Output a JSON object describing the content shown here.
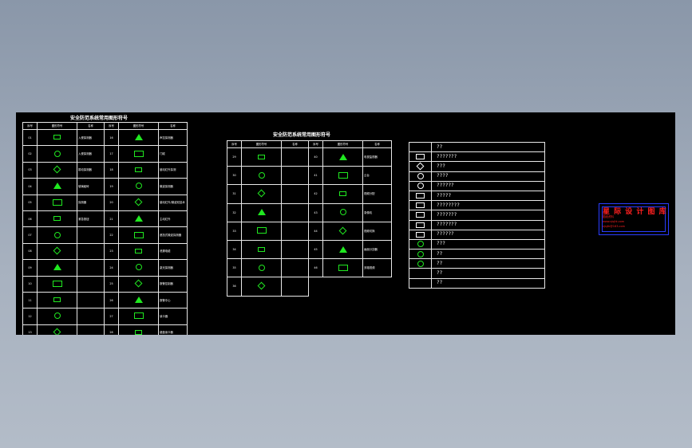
{
  "table1": {
    "title": "安全防范系统常用图形符号",
    "headers": [
      "序号",
      "图形符号",
      "名称",
      "序号",
      "图形符号",
      "名称"
    ],
    "rows": [
      [
        "01",
        "",
        "入侵探测器",
        "16",
        "",
        "声控探测器"
      ],
      [
        "02",
        "",
        "入侵探测器",
        "17",
        "",
        "门磁"
      ],
      [
        "03",
        "",
        "振动探测器",
        "18",
        "",
        "被动红外探测"
      ],
      [
        "04",
        "",
        "玻璃破碎",
        "19",
        "",
        "微波探测器"
      ],
      [
        "05",
        "",
        "探测器",
        "20",
        "",
        "被动红外/微波双技术"
      ],
      [
        "06",
        "",
        "紧急按钮",
        "21",
        "",
        "主动红外"
      ],
      [
        "07",
        "",
        "",
        "22",
        "",
        "遮挡式微波探测器"
      ],
      [
        "08",
        "",
        "",
        "23",
        "",
        "泄漏电缆"
      ],
      [
        "09",
        "",
        "",
        "24",
        "",
        "激光探测器"
      ],
      [
        "10",
        "",
        "",
        "25",
        "",
        "报警控制器"
      ],
      [
        "11",
        "",
        "",
        "26",
        "",
        "报警中心"
      ],
      [
        "12",
        "",
        "",
        "27",
        "",
        "读卡器"
      ],
      [
        "13",
        "",
        "",
        "28",
        "",
        "键盘读卡器"
      ]
    ]
  },
  "table2": {
    "title": "安全防范系统常用图形符号",
    "headers": [
      "序号",
      "图形符号",
      "名称",
      "序号",
      "图形符号",
      "名称"
    ],
    "rows": [
      [
        "29",
        "",
        "",
        "40",
        "",
        "电视监视器"
      ],
      [
        "30",
        "",
        "",
        "41",
        "",
        "云台"
      ],
      [
        "31",
        "",
        "",
        "42",
        "",
        "视频分配"
      ],
      [
        "32",
        "",
        "",
        "43",
        "",
        "录像机"
      ],
      [
        "33",
        "",
        "",
        "44",
        "",
        "视频切换"
      ],
      [
        "34",
        "",
        "",
        "45",
        "",
        "画面分割器"
      ],
      [
        "35",
        "",
        "",
        "46",
        "",
        "多路视频"
      ],
      [
        "36",
        "",
        "",
        "",
        "",
        ""
      ]
    ]
  },
  "table3": {
    "rows": [
      {
        "icon": "",
        "label": "??"
      },
      {
        "icon": "box",
        "label": "???????"
      },
      {
        "icon": "diamond",
        "label": "???"
      },
      {
        "icon": "round",
        "label": "????"
      },
      {
        "icon": "round",
        "label": "??????"
      },
      {
        "icon": "box",
        "label": "?????"
      },
      {
        "icon": "box",
        "label": "????????"
      },
      {
        "icon": "box",
        "label": "???????"
      },
      {
        "icon": "box",
        "label": "???????"
      },
      {
        "icon": "box",
        "label": "??????"
      },
      {
        "icon": "green",
        "label": "???"
      },
      {
        "icon": "green",
        "label": "??"
      },
      {
        "icon": "green",
        "label": "??"
      },
      {
        "icon": "",
        "label": "??"
      },
      {
        "icon": "",
        "label": "??"
      }
    ]
  },
  "stamp": {
    "title": "星 际 设 计 图 库",
    "sub": "图纸资料",
    "url": "www.xjsjtk.com",
    "mail": "xjsjtk@163.com"
  },
  "colors": {
    "canvas": "#000000",
    "symbol": "#20e820",
    "stamp_text": "#ff2020",
    "stamp_border": "#2a3cff"
  }
}
